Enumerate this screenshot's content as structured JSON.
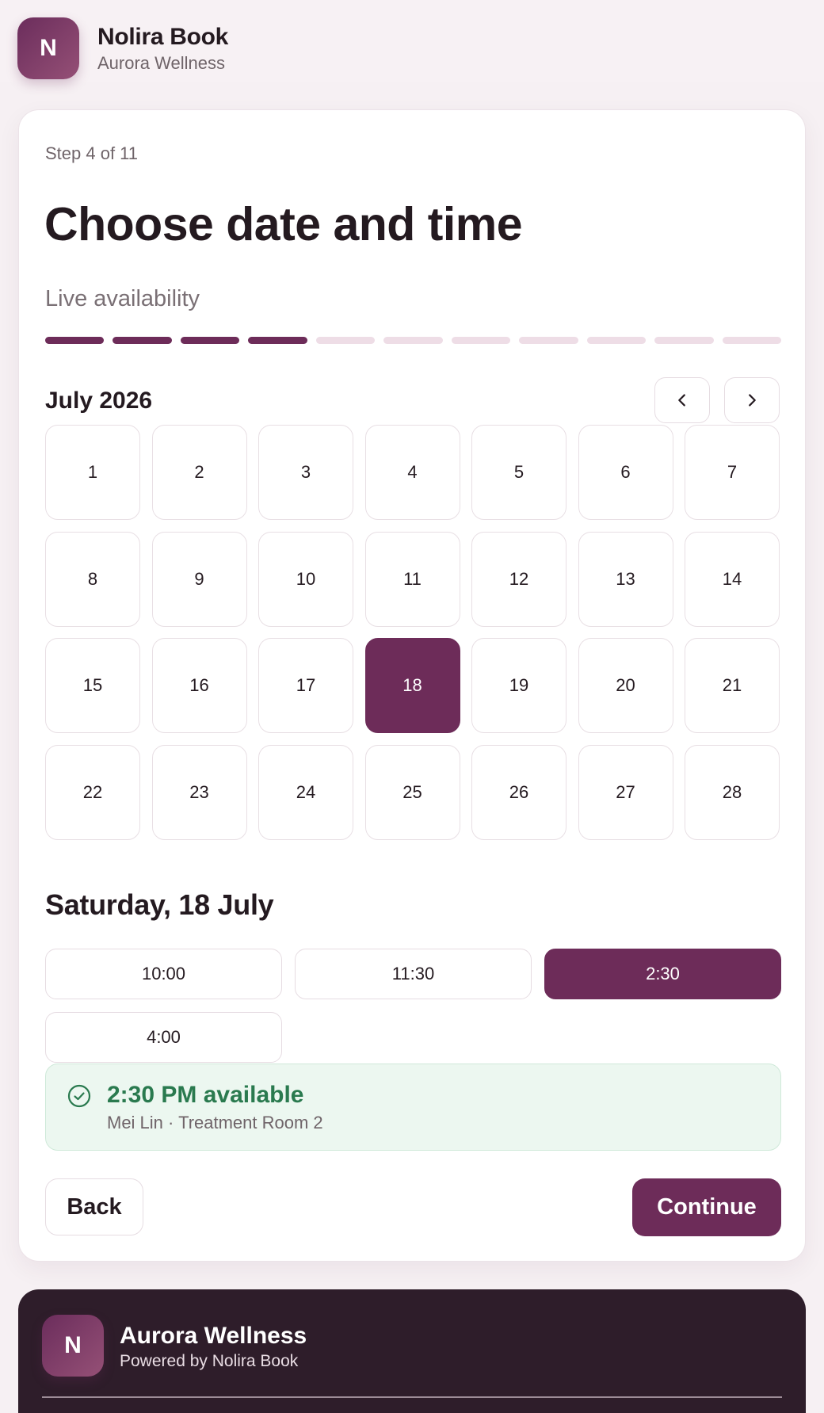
{
  "header": {
    "logo_letter": "N",
    "app_name": "Nolira Book",
    "business_name": "Aurora Wellness"
  },
  "booking": {
    "step_text": "Step 4 of 11",
    "title": "Choose date and time",
    "subtitle": "Live availability",
    "progress": {
      "current_step": 4,
      "total_steps": 11
    }
  },
  "calendar": {
    "month_label": "July 2026",
    "prev_icon": "chevron-left-icon",
    "next_icon": "chevron-right-icon",
    "days": [
      "1",
      "2",
      "3",
      "4",
      "5",
      "6",
      "7",
      "8",
      "9",
      "10",
      "11",
      "12",
      "13",
      "14",
      "15",
      "16",
      "17",
      "18",
      "19",
      "20",
      "21",
      "22",
      "23",
      "24",
      "25",
      "26",
      "27",
      "28"
    ],
    "selected_day": "18"
  },
  "timeslots": {
    "date_heading": "Saturday, 18 July",
    "slots": [
      "10:00",
      "11:30",
      "2:30",
      "4:00"
    ],
    "selected": "2:30"
  },
  "availability": {
    "icon": "check-circle-icon",
    "title": "2:30 PM available",
    "detail": "Mei Lin · Treatment Room 2"
  },
  "actions": {
    "back_label": "Back",
    "continue_label": "Continue"
  },
  "footer": {
    "logo_letter": "N",
    "business_name": "Aurora Wellness",
    "powered_by": "Powered by Nolira Book"
  },
  "colors": {
    "accent": "#6d2c59",
    "success_text": "#2a7a4f",
    "success_bg": "#ecf7f0",
    "footer_bg": "#2e1d2a"
  }
}
